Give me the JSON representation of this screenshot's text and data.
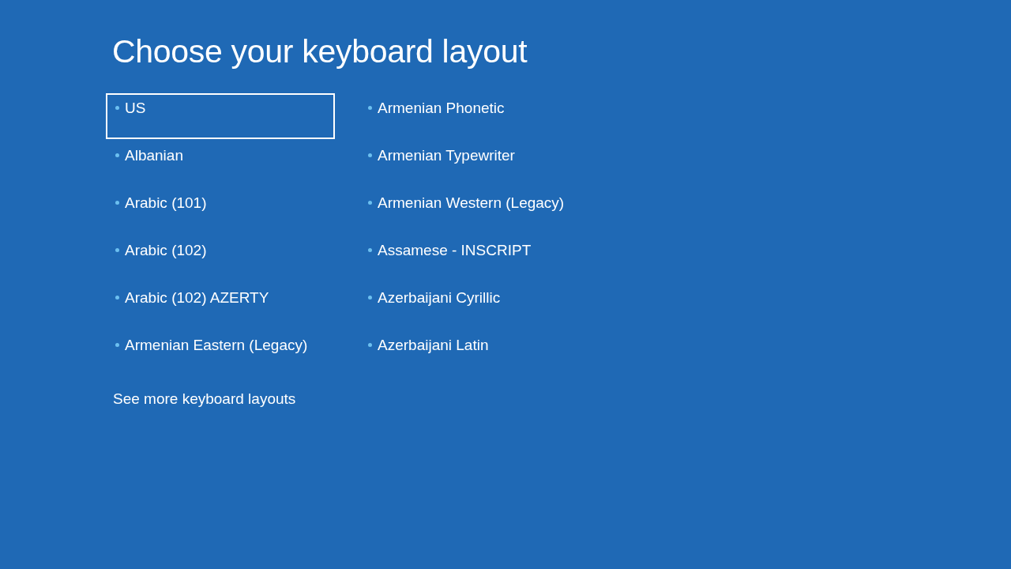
{
  "title": "Choose your keyboard layout",
  "columns": [
    {
      "items": [
        {
          "label": "US",
          "selected": true
        },
        {
          "label": "Albanian",
          "selected": false
        },
        {
          "label": "Arabic (101)",
          "selected": false
        },
        {
          "label": "Arabic (102)",
          "selected": false
        },
        {
          "label": "Arabic (102) AZERTY",
          "selected": false
        },
        {
          "label": "Armenian Eastern (Legacy)",
          "selected": false
        }
      ]
    },
    {
      "items": [
        {
          "label": "Armenian Phonetic",
          "selected": false
        },
        {
          "label": "Armenian Typewriter",
          "selected": false
        },
        {
          "label": "Armenian Western (Legacy)",
          "selected": false
        },
        {
          "label": "Assamese - INSCRIPT",
          "selected": false
        },
        {
          "label": "Azerbaijani Cyrillic",
          "selected": false
        },
        {
          "label": "Azerbaijani Latin",
          "selected": false
        }
      ]
    }
  ],
  "more_link": "See more keyboard layouts"
}
